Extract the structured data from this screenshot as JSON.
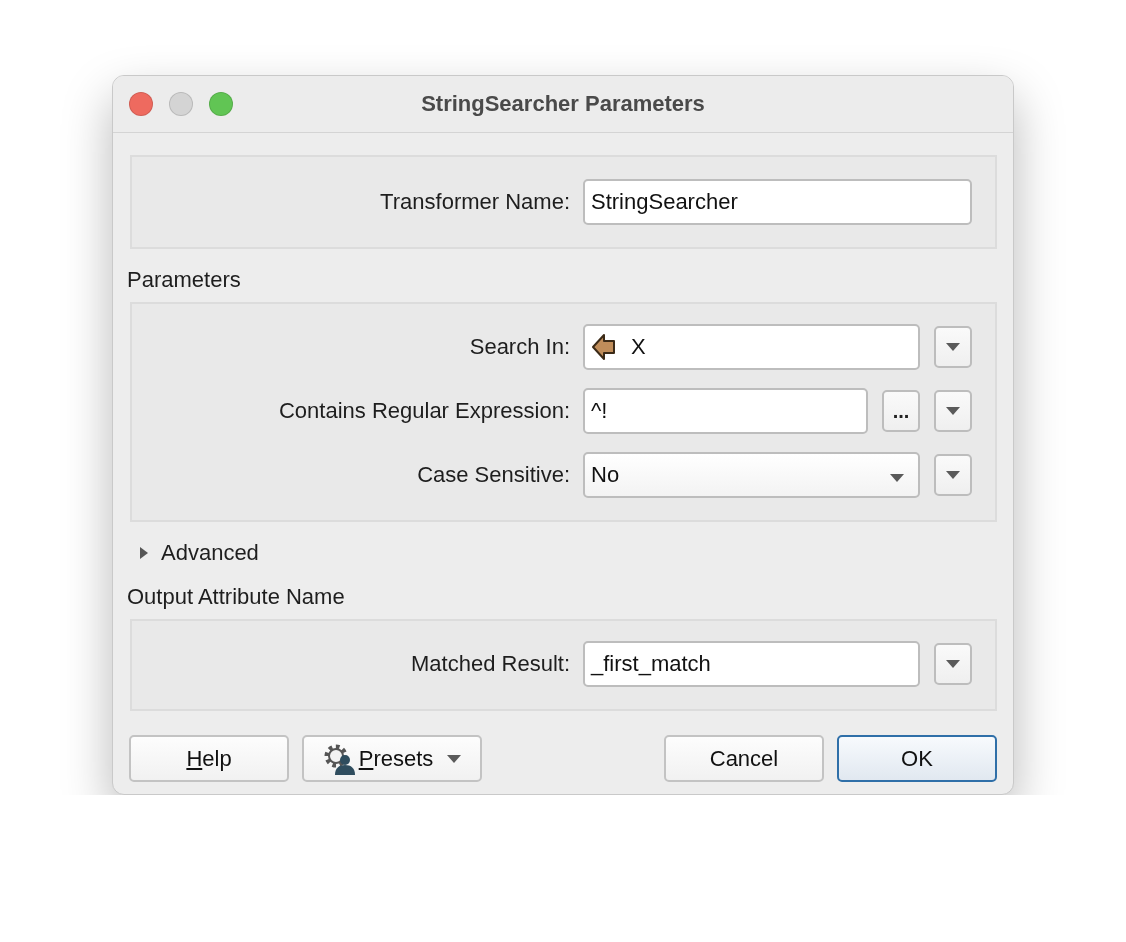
{
  "window": {
    "title": "StringSearcher Parameters"
  },
  "name_group": {
    "rows": [
      {
        "kind": "text",
        "label": "Transformer Name:",
        "value": "StringSearcher"
      }
    ]
  },
  "parameters": {
    "title": "Parameters",
    "rows": [
      {
        "kind": "attribute",
        "label": "Search In:",
        "value": "X"
      },
      {
        "kind": "expression",
        "label": "Contains Regular Expression:",
        "value": "^!",
        "ellipsis": "..."
      },
      {
        "kind": "choice",
        "label": "Case Sensitive:",
        "value": "No"
      }
    ]
  },
  "advanced": {
    "label": "Advanced",
    "expanded": false
  },
  "output": {
    "title": "Output Attribute Name",
    "rows": [
      {
        "kind": "attribute_name",
        "label": "Matched Result:",
        "value": "_first_match"
      }
    ]
  },
  "buttons": [
    {
      "kind": "plain",
      "label": "Help",
      "mnemonic": true,
      "default": false
    },
    {
      "kind": "presets",
      "label": "Presets",
      "mnemonic": true,
      "default": false
    },
    {
      "kind": "plain",
      "label": "Cancel",
      "mnemonic": false,
      "default": false
    },
    {
      "kind": "plain",
      "label": "OK",
      "mnemonic": false,
      "default": true
    }
  ]
}
